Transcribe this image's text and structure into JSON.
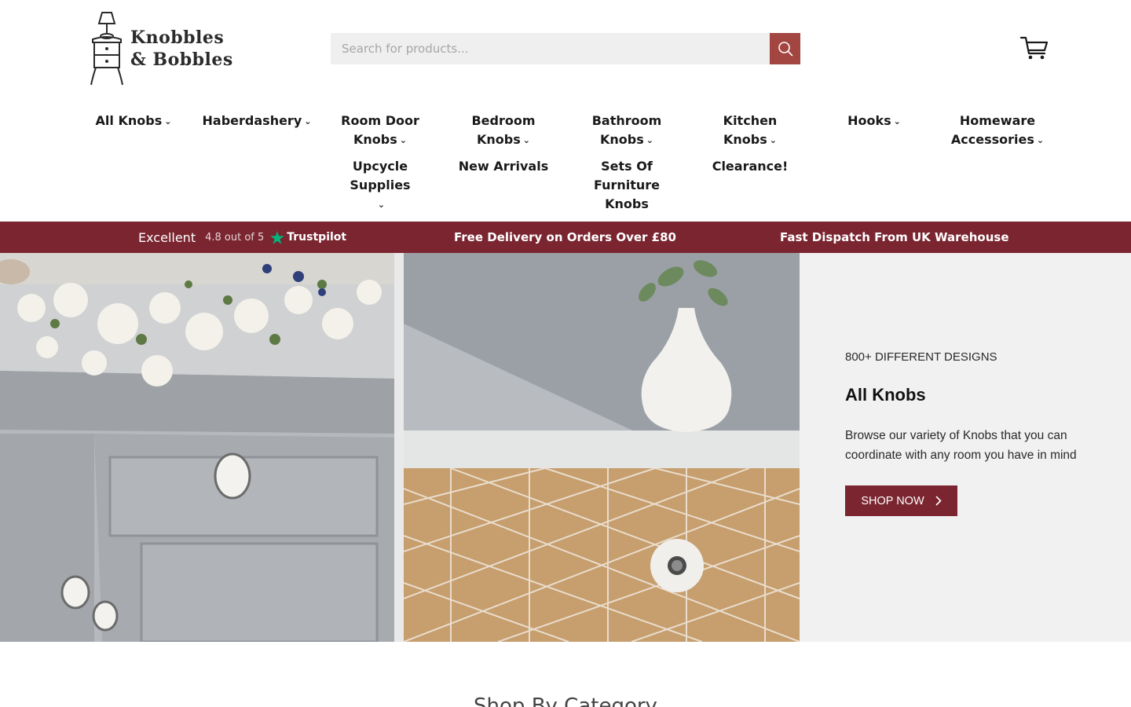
{
  "logo": {
    "line1": "Knobbles",
    "line2": "& Bobbles"
  },
  "search": {
    "placeholder": "Search for products..."
  },
  "icons": {
    "search": "search-icon",
    "cart": "cart-icon",
    "chevron": "chevron-down-icon",
    "trustpilot_star": "star-icon",
    "shop_now_arrow": "chevron-right-icon"
  },
  "nav": {
    "items": [
      {
        "label": "All Knobs",
        "has_dropdown": true
      },
      {
        "label": "Haberdashery",
        "has_dropdown": true
      },
      {
        "label": "Room Door Knobs",
        "has_dropdown": true
      },
      {
        "label": "Bedroom Knobs",
        "has_dropdown": true
      },
      {
        "label": "Bathroom Knobs",
        "has_dropdown": true
      },
      {
        "label": "Kitchen Knobs",
        "has_dropdown": true
      },
      {
        "label": "Hooks",
        "has_dropdown": true
      },
      {
        "label": "Homeware Accessories",
        "has_dropdown": true
      },
      {
        "label": "Upcycle Supplies",
        "has_dropdown": true
      },
      {
        "label": "New Arrivals",
        "has_dropdown": false
      },
      {
        "label": "Sets Of Furniture Knobs",
        "has_dropdown": false
      },
      {
        "label": "Clearance!",
        "has_dropdown": false
      }
    ]
  },
  "strip": {
    "trustpilot": {
      "rating_word": "Excellent",
      "score": "4.8 out of 5",
      "brand": "Trustpilot"
    },
    "delivery": "Free Delivery on Orders Over £80",
    "dispatch": "Fast Dispatch From UK Warehouse"
  },
  "hero": {
    "kicker": "800+ DIFFERENT DESIGNS",
    "title": "All Knobs",
    "description": "Browse our variety of Knobs that you can coordinate with any room you have in mind",
    "cta": "SHOP NOW"
  },
  "section": {
    "title": "Shop By Category"
  },
  "colors": {
    "accent": "#7a2530",
    "search_button": "#a34540",
    "search_bg": "#efefef"
  }
}
